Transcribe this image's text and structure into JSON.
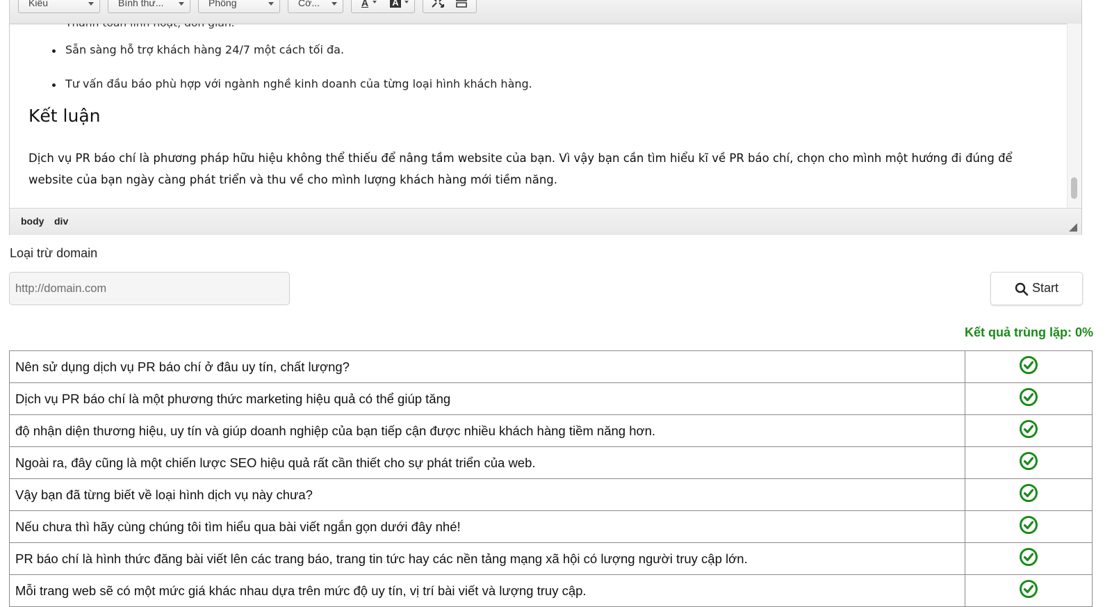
{
  "toolbar": {
    "style_combo": "Kiểu",
    "format_combo": "Bình thư...",
    "font_combo": "Phông",
    "size_combo": "Cỡ...",
    "text_color_icon": "text-color-icon",
    "bg_color_icon": "background-color-icon",
    "maximize_icon": "maximize-icon",
    "show_blocks_icon": "show-blocks-icon"
  },
  "editor": {
    "cut_off_line": "Thanh toán linh hoạt, đơn giản.",
    "bullets": [
      "Sẵn sàng hỗ trợ khách hàng 24/7 một cách tối đa.",
      "Tư vấn đầu báo phù hợp với ngành nghề kinh doanh của từng loại hình khách hàng."
    ],
    "heading": "Kết luận",
    "paragraph": "Dịch vụ PR báo chí là phương pháp hữu hiệu không thể thiếu để nâng tầm website của bạn. Vì vậy bạn cần tìm hiểu kĩ về PR báo chí, chọn cho mình một hướng đi đúng để website của bạn ngày càng phát triển và thu về cho mình lượng khách hàng mới tiềm năng."
  },
  "statusbar": {
    "path": [
      "body",
      "div"
    ]
  },
  "exclude": {
    "label": "Loại trừ domain",
    "placeholder": "http://domain.com",
    "value": ""
  },
  "start_button": {
    "label": "Start",
    "icon": "search-icon"
  },
  "result_summary": "Kết quả trùng lặp: 0%",
  "colors": {
    "ok_green": "#1b8a1b"
  },
  "results": [
    {
      "text": "Nên sử dụng dịch vụ PR báo chí ở đâu uy tín, chất lượng?",
      "status": "check-circle-icon"
    },
    {
      "text": "Dịch vụ PR báo chí là một phương thức marketing hiệu quả có thể giúp tăng",
      "status": "check-circle-icon"
    },
    {
      "text": "độ nhận diện thương hiệu, uy tín và giúp doanh nghiệp của bạn tiếp cận được nhiều khách hàng tiềm năng hơn.",
      "status": "check-circle-icon"
    },
    {
      "text": "Ngoài ra, đây cũng là một chiến lược SEO hiệu quả rất cần thiết cho sự phát triển của web.",
      "status": "check-circle-icon"
    },
    {
      "text": "Vậy bạn đã từng biết về loại hình dịch vụ này chưa?",
      "status": "check-circle-icon"
    },
    {
      "text": "Nếu chưa thì hãy cùng chúng tôi tìm hiểu qua bài viết ngắn gọn dưới đây nhé!",
      "status": "check-circle-icon"
    },
    {
      "text": "PR báo chí là hình thức đăng bài viết lên các trang báo, trang tin tức hay các nền tảng mạng xã hội có lượng người truy cập lớn.",
      "status": "check-circle-icon"
    },
    {
      "text": "Mỗi trang web sẽ có một mức giá khác nhau dựa trên mức độ uy tín, vị trí bài viết và lượng truy cập.",
      "status": "check-circle-icon"
    }
  ]
}
